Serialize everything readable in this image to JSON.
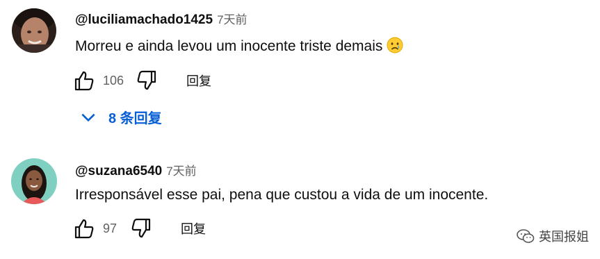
{
  "comments": [
    {
      "handle": "@luciliamachado1425",
      "time": "7天前",
      "text": "Morreu e ainda levou um inocente triste demais",
      "emoji": "crying-face",
      "likes": "106",
      "reply_label": "回复",
      "replies_toggle": "8 条回复"
    },
    {
      "handle": "@suzana6540",
      "time": "7天前",
      "text": "Irresponsável esse pai, pena que custou a vida de um inocente.",
      "likes": "97",
      "reply_label": "回复"
    }
  ],
  "watermark": {
    "text": "英国报姐"
  },
  "colors": {
    "link_blue": "#065fd4",
    "secondary_text": "#606060",
    "primary_text": "#0f0f0f"
  }
}
